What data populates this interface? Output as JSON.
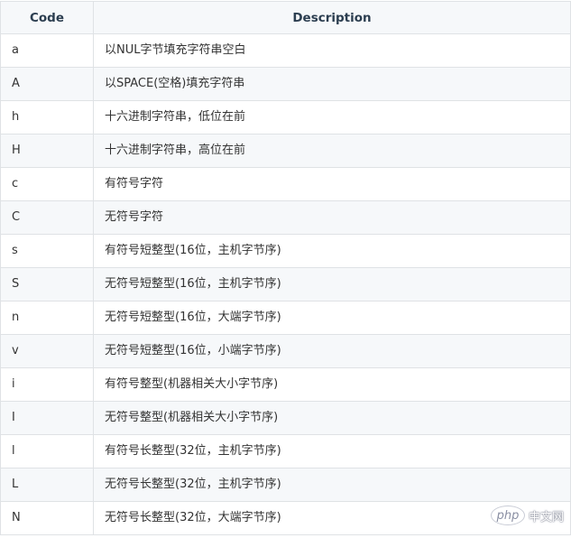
{
  "table": {
    "headers": {
      "code": "Code",
      "description": "Description"
    },
    "rows": [
      {
        "code": "a",
        "description": "以NUL字节填充字符串空白"
      },
      {
        "code": "A",
        "description": "以SPACE(空格)填充字符串"
      },
      {
        "code": "h",
        "description": "十六进制字符串，低位在前"
      },
      {
        "code": "H",
        "description": "十六进制字符串，高位在前"
      },
      {
        "code": "c",
        "description": "有符号字符"
      },
      {
        "code": "C",
        "description": "无符号字符"
      },
      {
        "code": "s",
        "description": "有符号短整型(16位，主机字节序)"
      },
      {
        "code": "S",
        "description": "无符号短整型(16位，主机字节序)"
      },
      {
        "code": "n",
        "description": "无符号短整型(16位，大端字节序)"
      },
      {
        "code": "v",
        "description": "无符号短整型(16位，小端字节序)"
      },
      {
        "code": "i",
        "description": "有符号整型(机器相关大小字节序)"
      },
      {
        "code": "I",
        "description": "无符号整型(机器相关大小字节序)"
      },
      {
        "code": "l",
        "description": "有符号长整型(32位，主机字节序)"
      },
      {
        "code": "L",
        "description": "无符号长整型(32位，主机字节序)"
      },
      {
        "code": "N",
        "description": "无符号长整型(32位，大端字节序)"
      }
    ]
  },
  "watermark": {
    "logo": "php",
    "text": "中文网"
  },
  "colors": {
    "header_bg": "#f6f8fa",
    "alt_row_bg": "#f6f8fa",
    "border": "#dfe2e5",
    "text": "#333333"
  }
}
